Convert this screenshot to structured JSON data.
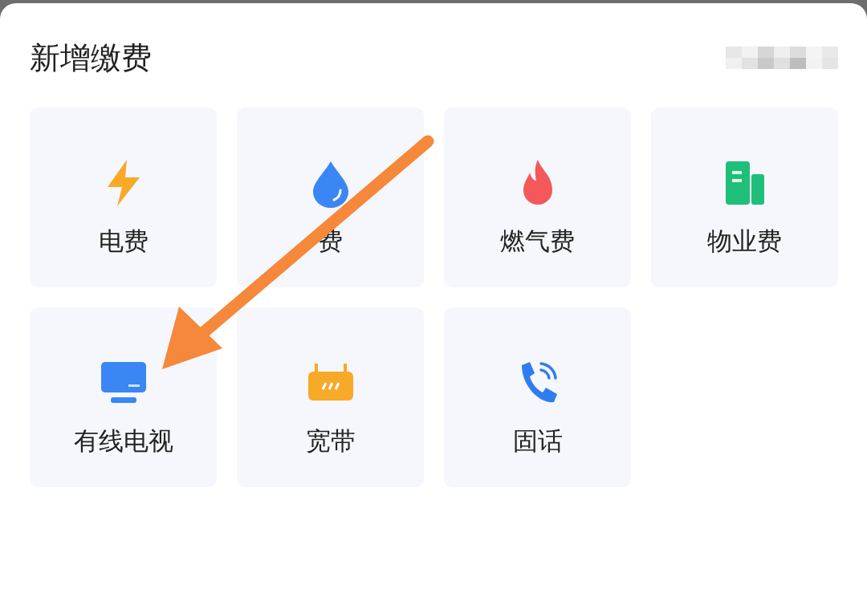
{
  "title": "新增缴费",
  "items": [
    {
      "label": "电费",
      "kind": "bolt"
    },
    {
      "label": "费",
      "kind": "drop"
    },
    {
      "label": "燃气费",
      "kind": "flame"
    },
    {
      "label": "物业费",
      "kind": "building"
    },
    {
      "label": "有线电视",
      "kind": "tv"
    },
    {
      "label": "宽带",
      "kind": "router"
    },
    {
      "label": "固话",
      "kind": "phone"
    }
  ]
}
